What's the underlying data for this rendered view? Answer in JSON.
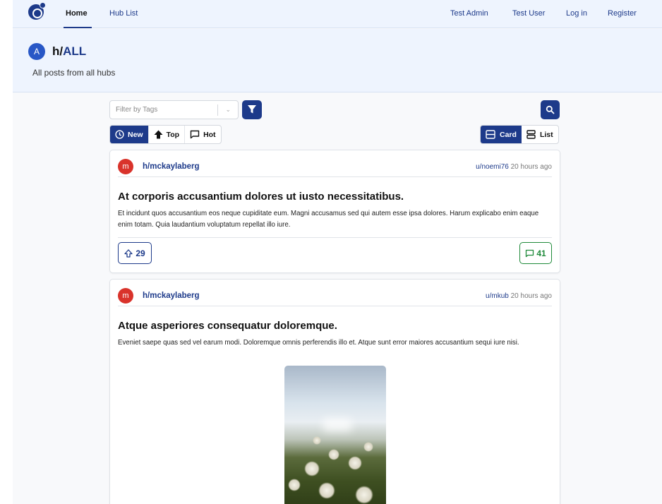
{
  "nav": {
    "links": [
      "Home",
      "Hub List"
    ],
    "right_links": [
      "Test Admin",
      "Test User",
      "Log in",
      "Register"
    ]
  },
  "hub": {
    "avatar_letter": "A",
    "title_prefix": "h/",
    "title_name": "ALL",
    "subtitle": "All posts from all hubs"
  },
  "filters": {
    "tags_placeholder": "Filter by Tags",
    "sort": [
      "New",
      "Top",
      "Hot"
    ],
    "sort_active": "New",
    "view": [
      "Card",
      "List"
    ],
    "view_active": "Card"
  },
  "posts": [
    {
      "avatar_letter": "m",
      "hub": "h/mckaylaberg",
      "user": "u/noemi76",
      "time": "20 hours ago",
      "title": "At corporis accusantium dolores ut iusto necessitatibus.",
      "body": "Et incidunt quos accusantium eos neque cupiditate eum. Magni accusamus sed qui autem esse ipsa dolores. Harum explicabo enim eaque enim totam. Quia laudantium voluptatum repellat illo iure.",
      "votes": "29",
      "comments": "41"
    },
    {
      "avatar_letter": "m",
      "hub": "h/mckaylaberg",
      "user": "u/mkub",
      "time": "20 hours ago",
      "title": "Atque asperiores consequatur doloremque.",
      "body": "Eveniet saepe quas sed vel earum modi. Doloremque omnis perferendis illo et. Atque sunt error maiores accusantium sequi iure nisi."
    }
  ],
  "colors": {
    "primary": "#1d3a8a",
    "accent_red": "#d9332b",
    "comment_green": "#1f8a3a",
    "header_bg": "#eef4fe"
  }
}
